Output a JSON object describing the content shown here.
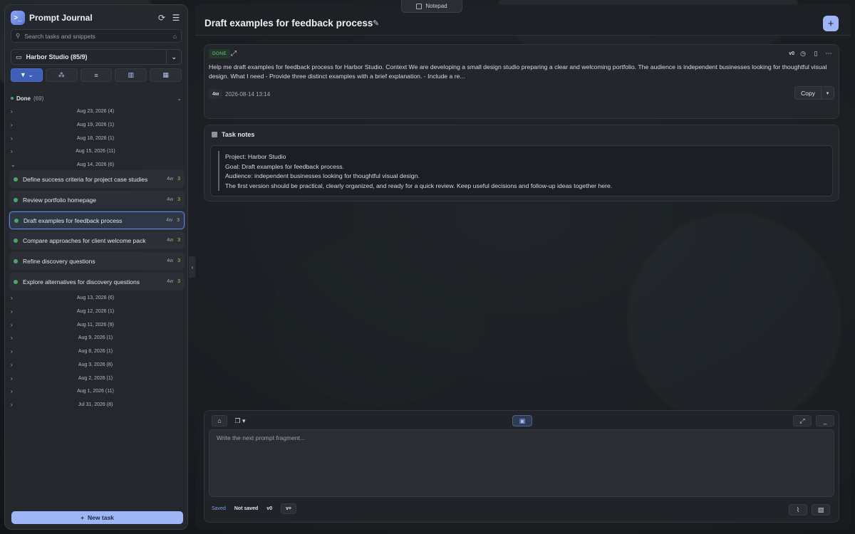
{
  "window": {
    "notepad_tab": "Notepad"
  },
  "sidebar": {
    "app_title": "Prompt Journal",
    "search_placeholder": "Search tasks and snippets",
    "project": "Harbor Studio (85/9)",
    "group": {
      "name": "Done",
      "count": "(69)"
    },
    "dates_top": [
      {
        "label": "Aug 23, 2026 (4)"
      },
      {
        "label": "Aug 19, 2026 (1)"
      },
      {
        "label": "Aug 18, 2026 (1)"
      },
      {
        "label": "Aug 15, 2026 (11)"
      },
      {
        "label": "Aug 14, 2026 (6)"
      }
    ],
    "tasks": [
      {
        "title": "Define success criteria for project case studies",
        "age": "4w",
        "count": "3"
      },
      {
        "title": "Review portfolio homepage",
        "age": "4w",
        "count": "3"
      },
      {
        "title": "Draft examples for feedback process",
        "age": "4w",
        "count": "3"
      },
      {
        "title": "Compare approaches for client welcome pack",
        "age": "4w",
        "count": "3"
      },
      {
        "title": "Refine discovery questions",
        "age": "4w",
        "count": "3"
      },
      {
        "title": "Explore alternatives for discovery questions",
        "age": "4w",
        "count": "3"
      }
    ],
    "dates_bottom": [
      {
        "label": "Aug 13, 2026 (6)"
      },
      {
        "label": "Aug 12, 2026 (1)"
      },
      {
        "label": "Aug 11, 2026 (9)"
      },
      {
        "label": "Aug 9, 2026 (1)"
      },
      {
        "label": "Aug 8, 2026 (1)"
      },
      {
        "label": "Aug 3, 2026 (8)"
      },
      {
        "label": "Aug 2, 2026 (1)"
      },
      {
        "label": "Aug 1, 2026 (11)"
      },
      {
        "label": "Jul 31, 2026 (8)"
      }
    ],
    "new_task_label": "New task"
  },
  "main": {
    "title": "Draft examples for feedback process",
    "prompt": {
      "status": "DONE",
      "version": "v0",
      "text": "Help me draft examples for feedback process for Harbor Studio. Context We are developing a small design studio preparing a clear and welcoming portfolio. The audience is independent businesses looking for thoughtful visual design. What I need - Provide three distinct examples with a brief explanation. - Include a re...",
      "age": "4w",
      "timestamp": "2026-08-14 13:14",
      "copy_label": "Copy"
    },
    "notes": {
      "heading": "Task notes",
      "lines": [
        "Project: Harbor Studio",
        "Goal: Draft examples for feedback process.",
        "Audience: independent businesses looking for thoughtful visual design.",
        "The first version should be practical, clearly organized, and ready for a quick review. Keep useful decisions and follow-up ideas together here."
      ]
    },
    "composer": {
      "placeholder": "Write the next prompt fragment...",
      "saved": "Saved",
      "not_saved": "Not saved",
      "version": "v0",
      "version_add": "v+"
    }
  },
  "colors": {
    "accent": "#9eb6f5",
    "done": "#4ea56b",
    "selected_border": "#5f7fd6"
  }
}
